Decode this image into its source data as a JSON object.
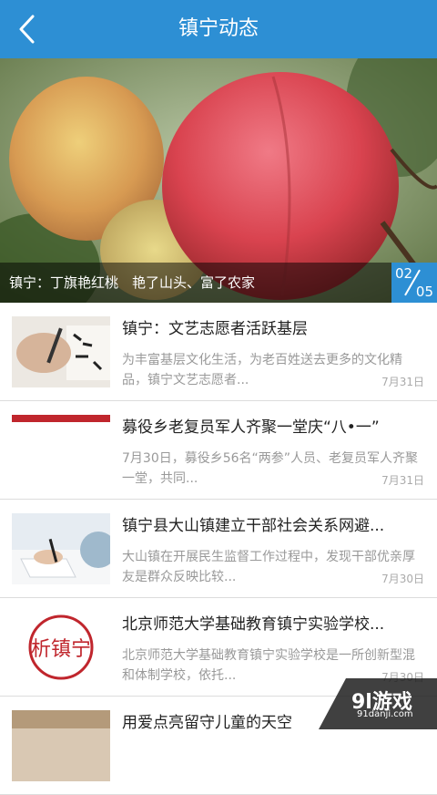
{
  "header": {
    "title": "镇宁动态"
  },
  "banner": {
    "caption": "镇宁：丁旗艳红桃　艳了山头、富了农家",
    "current": "02",
    "total": "05"
  },
  "news": [
    {
      "title": "镇宁：文艺志愿者活跃基层",
      "desc": "为丰富基层文化生活，为老百姓送去更多的文化精品，镇宁文艺志愿者...",
      "date": "7月31日"
    },
    {
      "title": "募役乡老复员军人齐聚一堂庆“八•一”",
      "desc": "7月30日，募役乡56名“两参”人员、老复员军人齐聚一堂，共同...",
      "date": "7月31日"
    },
    {
      "title": "镇宁县大山镇建立干部社会关系网避...",
      "desc": "大山镇在开展民生监督工作过程中，发现干部优亲厚友是群众反映比较...",
      "date": "7月30日"
    },
    {
      "title": "北京师范大学基础教育镇宁实验学校...",
      "desc": "北京师范大学基础教育镇宁实验学校是一所创新型混和体制学校，依托...",
      "date": "7月30日"
    },
    {
      "title": "用爱点亮留守儿童的天空",
      "desc": "",
      "date": ""
    }
  ],
  "thumb_text": "析镇宁",
  "watermark": {
    "text": "9l游戏",
    "url": "91danji.com"
  }
}
